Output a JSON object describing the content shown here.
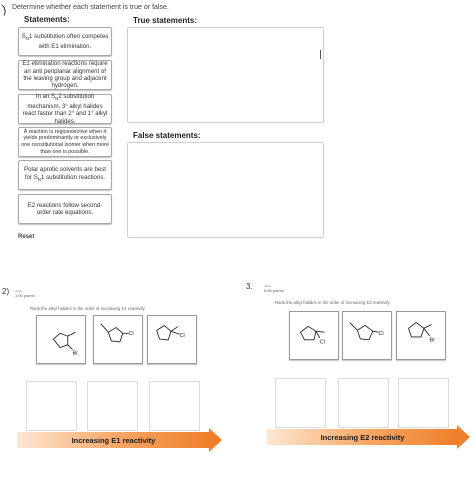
{
  "top": {
    "question_marker": ")",
    "instruction": "Determine whether each statement is true or false.",
    "statements_heading": "Statements:",
    "true_heading": "True statements:",
    "false_heading": "False statements:",
    "reset_label": "Reset",
    "statements": [
      {
        "prefix": "S",
        "sub": "N",
        "suffix": "1 substitution often competes with E1 elimination."
      },
      {
        "text": "E1 elimination reactions require an anti periplanar alignment of the leaving group and adjacent hydrogen."
      },
      {
        "prefix": "In an S",
        "sub": "N",
        "suffix": "2 substitution mechanism, 3° alkyl halides react faster than 2° and 1° alkyl halides."
      },
      {
        "text": "A reaction is regioselective when it yields predominantly or exclusively one constitutional isomer when more than one is possible."
      },
      {
        "prefix": "Polar aprotic solvents are best for S",
        "sub": "N",
        "suffix": "1 substitution reactions."
      },
      {
        "text": "E2 reactions follow second-order rate equations."
      }
    ]
  },
  "panel_e1": {
    "number": "2)",
    "small_label": "value",
    "points": "1.00 points",
    "instruction": "Rank the alkyl halides in the order of increasing E1 reactivity",
    "molecules": [
      {
        "label": "Br",
        "icon": "methylcyclopentyl-bromide-icon"
      },
      {
        "label": "Cl",
        "icon": "methylcyclopentyl-chloride-icon"
      },
      {
        "label": "Cl",
        "icon": "methylcyclopentyl-chloride-icon"
      }
    ],
    "arrow_label": "Increasing E1 reactivity"
  },
  "panel_e2": {
    "number": "3.",
    "small_label": "value",
    "points": "0.66 points",
    "instruction": "Rank the alkyl halides in the order of increasing E2 reactivity",
    "molecules": [
      {
        "label": "Cl",
        "icon": "methylcyclopentyl-chloride-icon"
      },
      {
        "label": "Cl",
        "icon": "methylcyclopentyl-chloride-icon"
      },
      {
        "label": "Br",
        "icon": "methylcyclopentyl-bromide-icon"
      }
    ],
    "arrow_label": "Increasing E2 reactivity"
  },
  "colors": {
    "arrow_light": "#fde7d3",
    "arrow_dark": "#ef7f2a",
    "border": "#a8a8a8"
  }
}
